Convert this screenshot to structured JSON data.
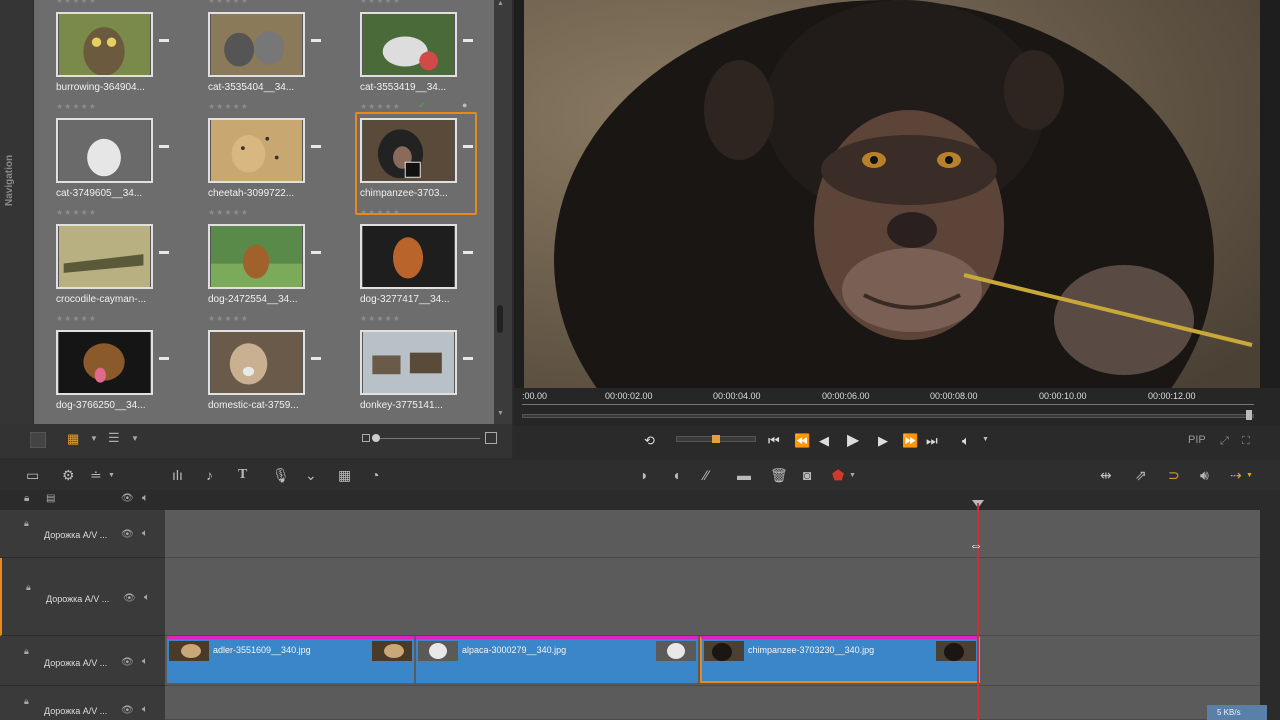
{
  "library": {
    "nav_label": "Navigation",
    "items": [
      {
        "caption": "burrowing-364904...",
        "stars": "★★★★★"
      },
      {
        "caption": "cat-3535404__34...",
        "stars": "★★★★★"
      },
      {
        "caption": "cat-3553419__34...",
        "stars": "★★★★★"
      },
      {
        "caption": "cat-3749605__34...",
        "stars": "★★★★★"
      },
      {
        "caption": "cheetah-3099722...",
        "stars": "★★★★★"
      },
      {
        "caption": "chimpanzee-3703...",
        "stars": "★★★★★"
      },
      {
        "caption": "crocodile-cayman-...",
        "stars": "★★★★★"
      },
      {
        "caption": "dog-2472554__34...",
        "stars": "★★★★★"
      },
      {
        "caption": "dog-3277417__34...",
        "stars": "★★★★★"
      },
      {
        "caption": "dog-3766250__34...",
        "stars": "★★★★★"
      },
      {
        "caption": "domestic-cat-3759...",
        "stars": "★★★★★"
      },
      {
        "caption": "donkey-3775141...",
        "stars": "★★★★★"
      }
    ],
    "selected_index": 5
  },
  "preview": {
    "ruler_ticks": [
      ":00.00",
      "00:00:02.00",
      "00:00:04.00",
      "00:00:06.00",
      "00:00:08.00",
      "00:00:10.00",
      "00:00:12.00"
    ],
    "pip_label": "PIP"
  },
  "timeline": {
    "tracks": [
      {
        "name": "Дорожка А/V ..."
      },
      {
        "name": "Дорожка А/V ..."
      },
      {
        "name": "Дорожка А/V ..."
      },
      {
        "name": "Дорожка А/V ..."
      }
    ],
    "clips": [
      {
        "name": "adler-3551609__340.jpg"
      },
      {
        "name": "alpaca-3000279__340.jpg"
      },
      {
        "name": "chimpanzee-3703230__340.jpg"
      }
    ],
    "status": "5 KB/s"
  },
  "colors": {
    "selection": "#e88a1a",
    "clip": "#3a86c8",
    "clip_border": "#e020c0",
    "playhead": "#c8303a"
  }
}
